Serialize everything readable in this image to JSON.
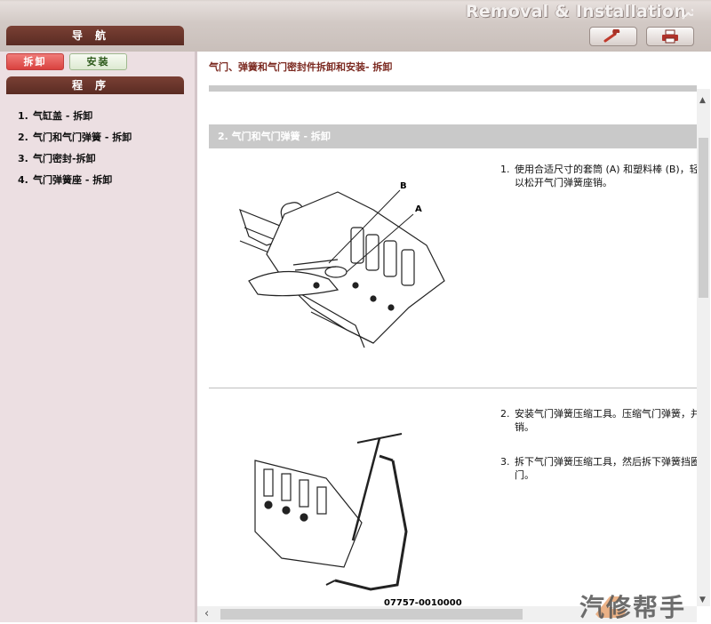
{
  "header": {
    "title": "Removal & Installation",
    "nav_label": "导航",
    "buttons": [
      {
        "name": "wrench-button",
        "icon": "wrench-icon"
      },
      {
        "name": "print-button",
        "icon": "printer-icon"
      }
    ]
  },
  "sidebar": {
    "remove_label": "拆卸",
    "install_label": "安装",
    "procedure_label": "程序",
    "items": [
      {
        "num": "1.",
        "label": "气缸盖 - 拆卸"
      },
      {
        "num": "2.",
        "label": "气门和气门弹簧 - 拆卸"
      },
      {
        "num": "3.",
        "label": "气门密封-拆卸"
      },
      {
        "num": "4.",
        "label": "气门弹簧座 - 拆卸"
      }
    ]
  },
  "main": {
    "doc_title": "气门、弹簧和气门密封件拆卸和安装- 拆卸",
    "section_title": "2. 气门和气门弹簧 - 拆卸",
    "figure1": {
      "label_b": "B",
      "label_a": "A"
    },
    "figure2": {
      "part_number": "07757-0010000"
    },
    "steps": [
      {
        "num": "1.",
        "lines": [
          "使用合适尺寸的套筒 (A) 和塑料棒 (B)，轻轻",
          "以松开气门弹簧座销。"
        ]
      },
      {
        "num": "2.",
        "lines": [
          "安装气门弹簧压缩工具。压缩气门弹簧，并",
          "销。"
        ]
      },
      {
        "num": "3.",
        "lines": [
          "拆下气门弹簧压缩工具，然后拆下弹簧挡圈",
          "门。"
        ]
      }
    ]
  },
  "watermark": {
    "text": "汽修帮手"
  },
  "colors": {
    "accent_dark": "#5a2c23",
    "remove_button": "#d9423f",
    "install_button": "#dde9d1",
    "doc_title": "#7c2b22",
    "sidebar_bg": "#ecdfe2"
  }
}
